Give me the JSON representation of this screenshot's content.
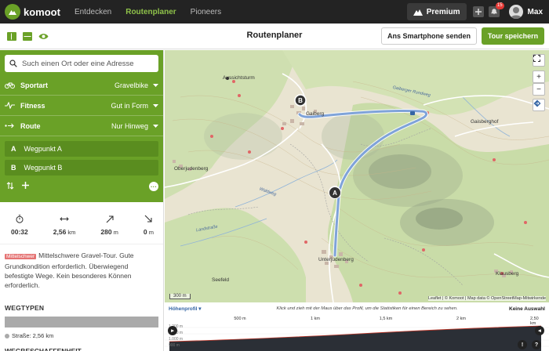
{
  "nav": {
    "logo": "komoot",
    "links": [
      "Entdecken",
      "Routenplaner",
      "Pioneers"
    ],
    "premium": "Premium",
    "notifications": "15",
    "user": "Max"
  },
  "subheader": {
    "title": "Routenplaner",
    "send": "Ans Smartphone senden",
    "save": "Tour speichern"
  },
  "sidebar": {
    "search_placeholder": "Such einen Ort oder eine Adresse",
    "options": [
      {
        "label": "Sportart",
        "value": "Gravelbike"
      },
      {
        "label": "Fitness",
        "value": "Gut in Form"
      },
      {
        "label": "Route",
        "value": "Nur Hinweg"
      }
    ],
    "waypoints": [
      {
        "letter": "A",
        "label": "Wegpunkt A"
      },
      {
        "letter": "B",
        "label": "Wegpunkt B"
      }
    ],
    "stats": [
      {
        "value": "00:32",
        "unit": ""
      },
      {
        "value": "2,56",
        "unit": " km"
      },
      {
        "value": "280",
        "unit": " m"
      },
      {
        "value": "0",
        "unit": " m"
      }
    ],
    "difficulty": "Mittelschwer",
    "description": "Mittelschwere Gravel-Tour. Gute Grundkondition erforderlich. Überwiegend befestigte Wege. Kein besonderes Können erforderlich.",
    "waytypes_title": "WEGTYPEN",
    "waytype_legend": "Straße: 2,56 km",
    "surface_title": "WEGBESCHAFFENHEIT"
  },
  "map": {
    "labels": {
      "aussicht": "Aussichtsturm",
      "gaiberg": "Gaiberg",
      "oberjuden": "Oberjudenberg",
      "unter": "Unterjudenberg",
      "klausberg": "Klausberg",
      "gaisberg": "Gaisberghof",
      "seefeld": "Seefeld",
      "road1": "Gaiberger Rundweg",
      "road2": "Waldweg",
      "road3": "Landstraße"
    },
    "scale": "300 m",
    "attribution": "Leaflet | © Komoot | Map data © OpenStreetMap-Mitwirkende"
  },
  "elevation": {
    "title": "Höhenprofil",
    "hint": "Klick und zieh mit der Maus über das Profil, um die Statistiken für einen Bereich zu sehen.",
    "auto": "Keine Auswahl",
    "ticks": [
      "500 m",
      "1 km",
      "1,5 km",
      "2 km",
      "2,50 km"
    ],
    "y_labels": [
      "1.200 m",
      "1.100 m",
      "1.000 m",
      "900 m"
    ]
  },
  "colors": {
    "brand": "#6aa127",
    "route": "#7fa3d9",
    "nav_bg": "#232323"
  }
}
